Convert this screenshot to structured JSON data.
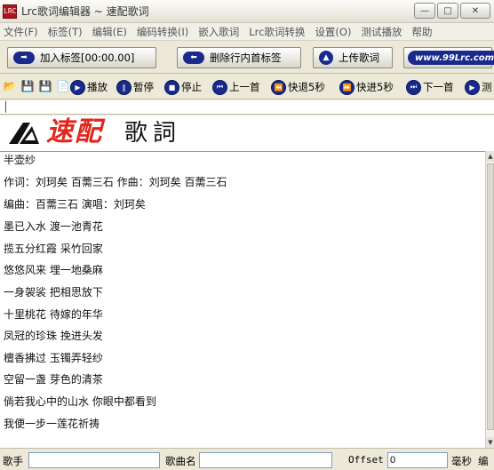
{
  "window": {
    "title": "Lrc歌词编辑器 ~ 速配歌词",
    "app_icon_text": "LRC",
    "minimize_icon": "minimize-icon",
    "maximize_icon": "maximize-icon",
    "close_icon": "close-icon"
  },
  "menu": [
    "文件(F)",
    "标签(T)",
    "编辑(E)",
    "编码转换(I)",
    "嵌入歌词",
    "Lrc歌词转换",
    "设置(O)",
    "测试播放",
    "帮助"
  ],
  "toolbar1": {
    "add_tag": "加入标签[00:00.00]",
    "delete_tag": "删除行内首标签",
    "upload": "上传歌词",
    "site": "www.99Lrc.com"
  },
  "toolbar2": {
    "play": "播放",
    "pause": "暂停",
    "stop": "停止",
    "prev": "上一首",
    "rewind": "快退5秒",
    "forward": "快进5秒",
    "next": "下一首",
    "more": "测"
  },
  "logo": {
    "red_text": "速配",
    "black_text": "歌詞"
  },
  "lyrics": [
    "半壶纱",
    "作词：刘珂矣 百薷三石 作曲：刘珂矣 百薷三石",
    "编曲：百薷三石 演唱：刘珂矣",
    "墨已入水 渡一池青花",
    "揽五分红霞 采竹回家",
    "悠悠风来 埋一地桑麻",
    "一身袈裟 把相思放下",
    "十里桃花 待嫁的年华",
    "凤冠的珍珠 挽进头发",
    "檀香拂过 玉镯弄轻纱",
    "空留一盏 芽色的清茶",
    "倘若我心中的山水 你眼中都看到",
    "我便一步一莲花祈祷"
  ],
  "status": {
    "singer_label": "歌手",
    "singer_value": "",
    "song_label": "歌曲名",
    "song_value": "",
    "offset_label": "Offset",
    "offset_value": "0",
    "ms_label": "毫秒",
    "edit_label": "编"
  }
}
